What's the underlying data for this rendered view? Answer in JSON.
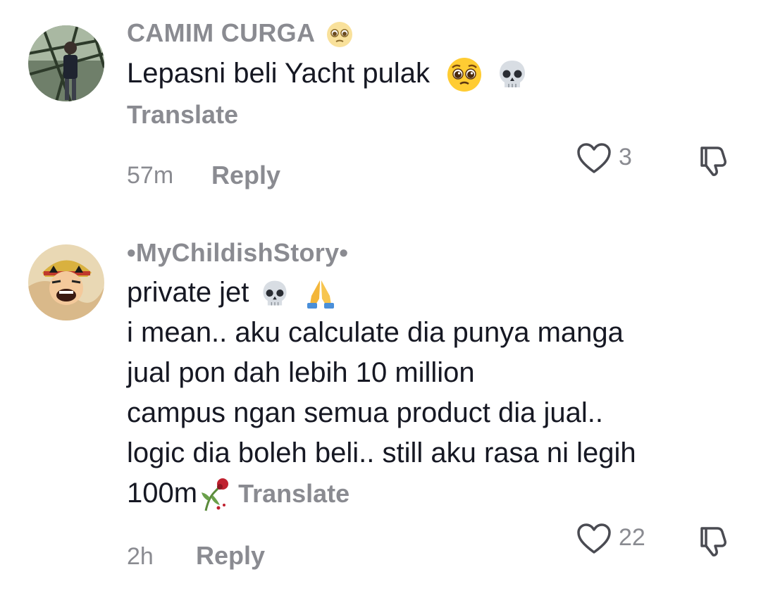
{
  "comments": [
    {
      "username": "CAMIM CURGA",
      "username_emoji": "pleading-face-icon",
      "text": "Lepasni beli Yacht pulak",
      "text_emojis": [
        "pleading-face-icon",
        "skull-icon"
      ],
      "translate_label": "Translate",
      "time": "57m",
      "reply_label": "Reply",
      "like_count": "3"
    },
    {
      "username": "•MyChildishStory•",
      "lines": [
        "private jet",
        "i mean.. aku calculate dia punya manga",
        "jual pon dah lebih 10 million",
        "campus ngan semua product dia jual..",
        "logic dia boleh beli.. still aku rasa ni legih",
        "100m"
      ],
      "line1_emojis": [
        "skull-icon",
        "folded-hands-icon"
      ],
      "last_line_emoji": "wilted-flower-icon",
      "translate_label": "Translate",
      "time": "2h",
      "reply_label": "Reply",
      "like_count": "22"
    }
  ],
  "colors": {
    "text": "#161823",
    "muted": "#8a8b91",
    "background": "#ffffff"
  }
}
